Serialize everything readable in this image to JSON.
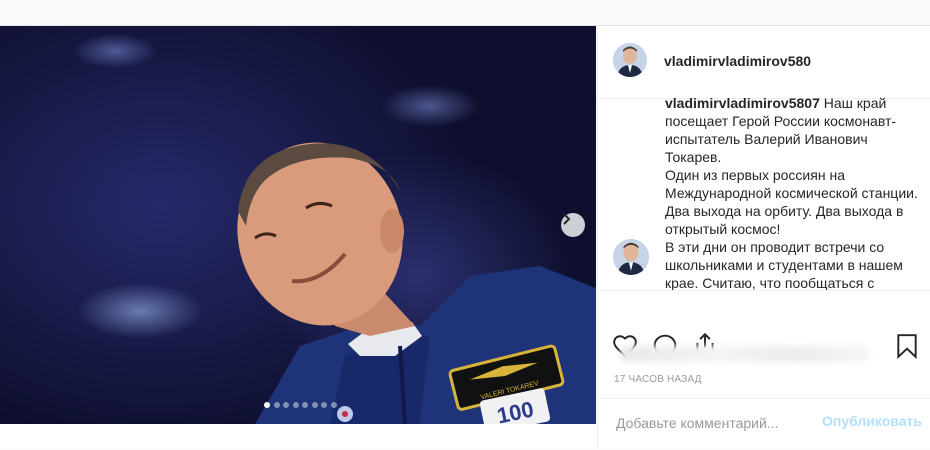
{
  "post": {
    "username": "vladimirvladimirov5807",
    "header_username": "vladimirvladimirov580",
    "caption_lines": [
      "Наш край посещает Герой России космонавт-испытатель Валерий Иванович Токарев.",
      "Один из первых россиян на Международной космической станции. Два выхода на орбиту. Два выхода в открытый космос!",
      "В эти дни он проводит встречи со школьниками и студентами в нашем крае. Считаю, что пообщаться с"
    ],
    "timestamp": "17 часов назад",
    "carousel": {
      "total": 8,
      "active": 1
    },
    "photo": {
      "patch_name": "VALERI TOKAREV",
      "patch_number": "100"
    }
  },
  "comment": {
    "placeholder": "Добавьте комментарий...",
    "post_label": "Опубликовать"
  },
  "icons": {
    "next": "chevron-right-icon",
    "like": "heart-icon",
    "comment": "comment-bubble-icon",
    "share": "share-icon",
    "save": "bookmark-icon"
  },
  "colors": {
    "link_disabled": "#b2dffc",
    "muted_text": "#999999",
    "text": "#262626"
  }
}
